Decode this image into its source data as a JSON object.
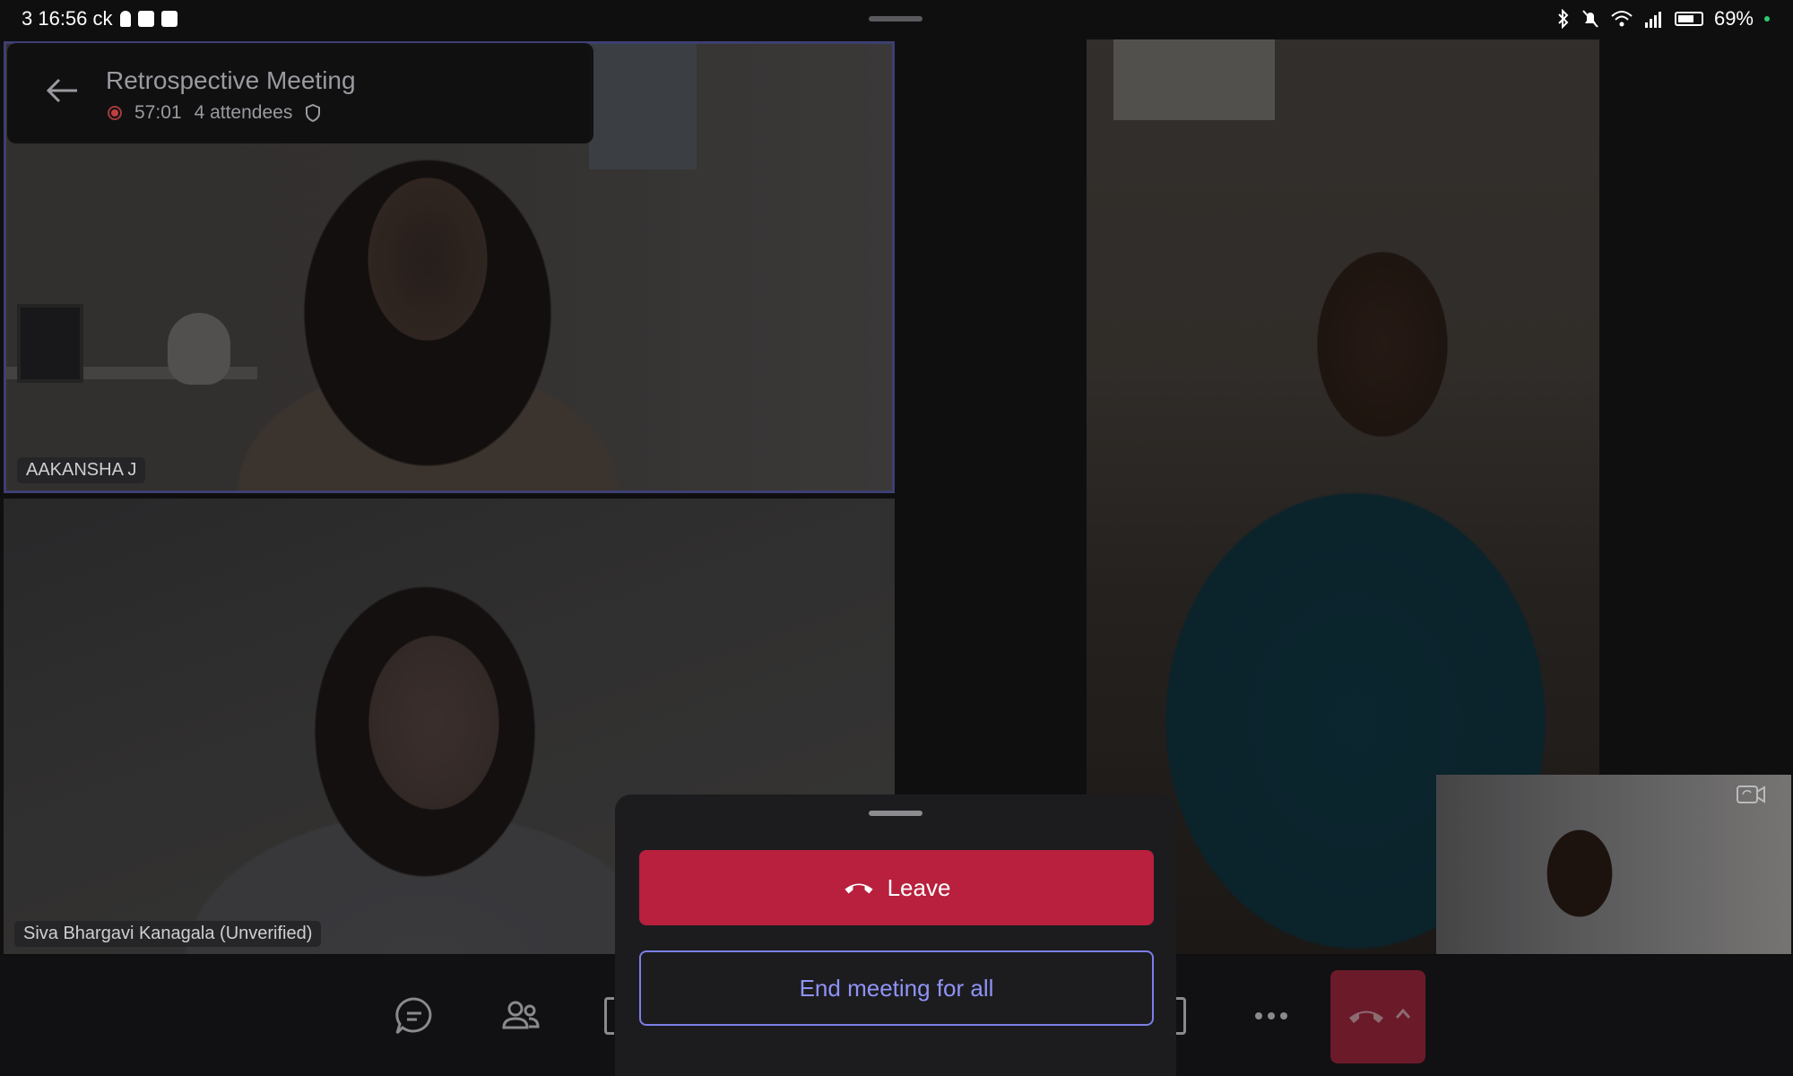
{
  "status_bar": {
    "time": "3 16:56 ck",
    "battery": "69%",
    "battery_level": 0.69
  },
  "meeting": {
    "title": "Retrospective Meeting",
    "duration": "57:01",
    "attendees": "4 attendees"
  },
  "participants": [
    {
      "name": "AAKANSHA J"
    },
    {
      "name": "Siva Bhargavi Kanagala (Unverified)"
    },
    {
      "name": ""
    },
    {
      "name": ""
    }
  ],
  "sheet": {
    "leave_label": "Leave",
    "end_label": "End meeting for all"
  },
  "colors": {
    "leave": "#b8203d",
    "end_border": "#7b7fe6",
    "active_speaker_border": "#3e3f72",
    "recording": "#c04040"
  },
  "icons": [
    "back-arrow-icon",
    "record-icon",
    "shield-icon",
    "chat-icon",
    "people-icon",
    "more-icon",
    "hang-up-icon",
    "chevron-up-icon",
    "switch-camera-icon"
  ]
}
